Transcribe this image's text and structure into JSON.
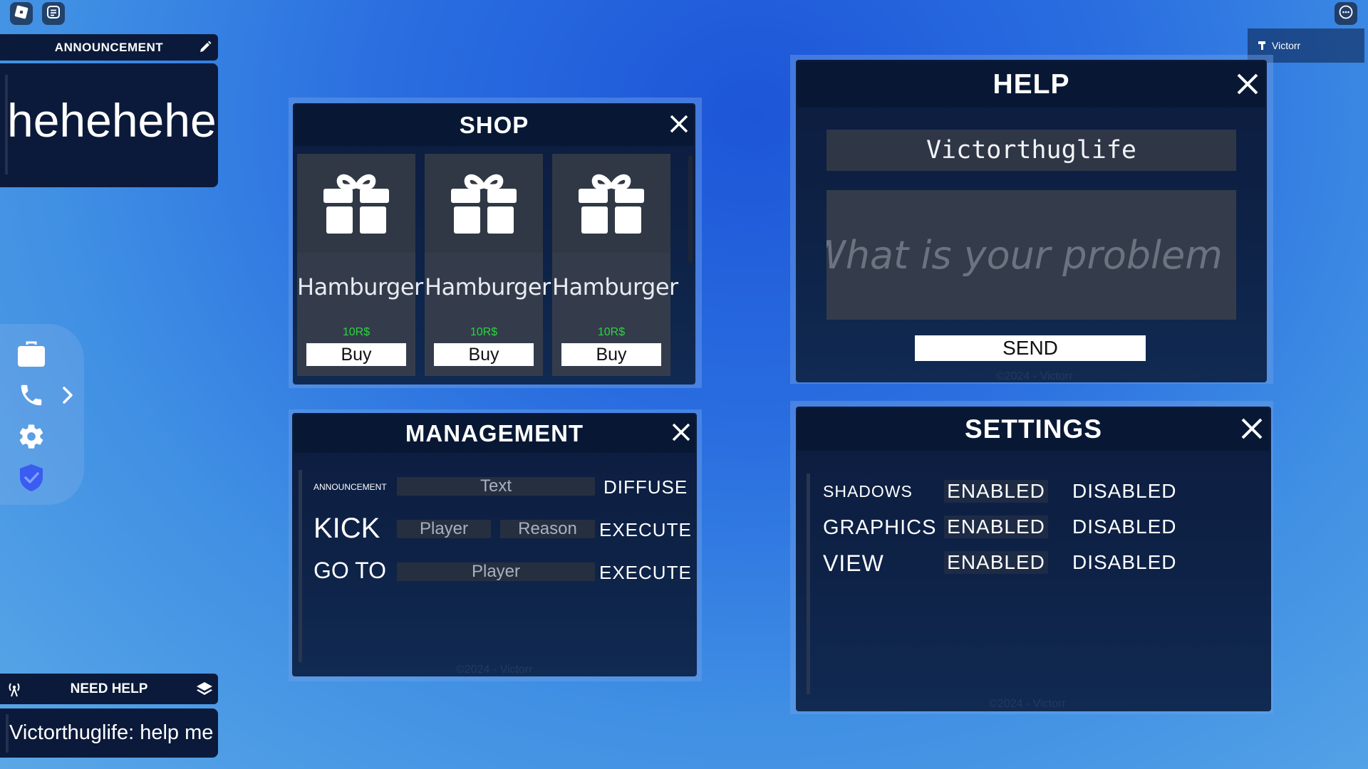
{
  "topbar": {
    "roblox_icon": "roblox-logo-icon",
    "chat_icon": "chat-icon",
    "menu_icon": "more-icon",
    "user_name": "Victorr"
  },
  "announcement": {
    "title": "ANNOUNCEMENT",
    "message": "hehehehe"
  },
  "dock": {
    "items": [
      "briefcase-icon",
      "phone-icon",
      "gear-icon",
      "shield-check-icon"
    ]
  },
  "need_help": {
    "title": "NEED HELP",
    "message": "Victorthuglife: help me"
  },
  "shop": {
    "title": "SHOP",
    "items": [
      {
        "name": "Hamburger",
        "price": "10R$",
        "buy": "Buy"
      },
      {
        "name": "Hamburger",
        "price": "10R$",
        "buy": "Buy"
      },
      {
        "name": "Hamburger",
        "price": "10R$",
        "buy": "Buy"
      }
    ]
  },
  "management": {
    "title": "MANAGEMENT",
    "rows": {
      "announcement": {
        "label": "ANNOUNCEMENT",
        "input": "Text",
        "action": "DIFFUSE"
      },
      "kick": {
        "label": "KICK",
        "player": "Player",
        "reason": "Reason",
        "action": "EXECUTE"
      },
      "goto": {
        "label": "GO TO",
        "player": "Player",
        "action": "EXECUTE"
      }
    },
    "footer": "©2024 - Victorr"
  },
  "help": {
    "title": "HELP",
    "username": "Victorthuglife",
    "placeholder": "What is your problem ?",
    "send": "SEND",
    "footer": "©2024 - Victorr"
  },
  "settings": {
    "title": "SETTINGS",
    "rows": [
      {
        "label": "SHADOWS",
        "enabled": "ENABLED",
        "disabled": "DISABLED"
      },
      {
        "label": "GRAPHICS",
        "enabled": "ENABLED",
        "disabled": "DISABLED"
      },
      {
        "label": "VIEW",
        "enabled": "ENABLED",
        "disabled": "DISABLED"
      }
    ],
    "footer": "©2024 - Victorr"
  }
}
